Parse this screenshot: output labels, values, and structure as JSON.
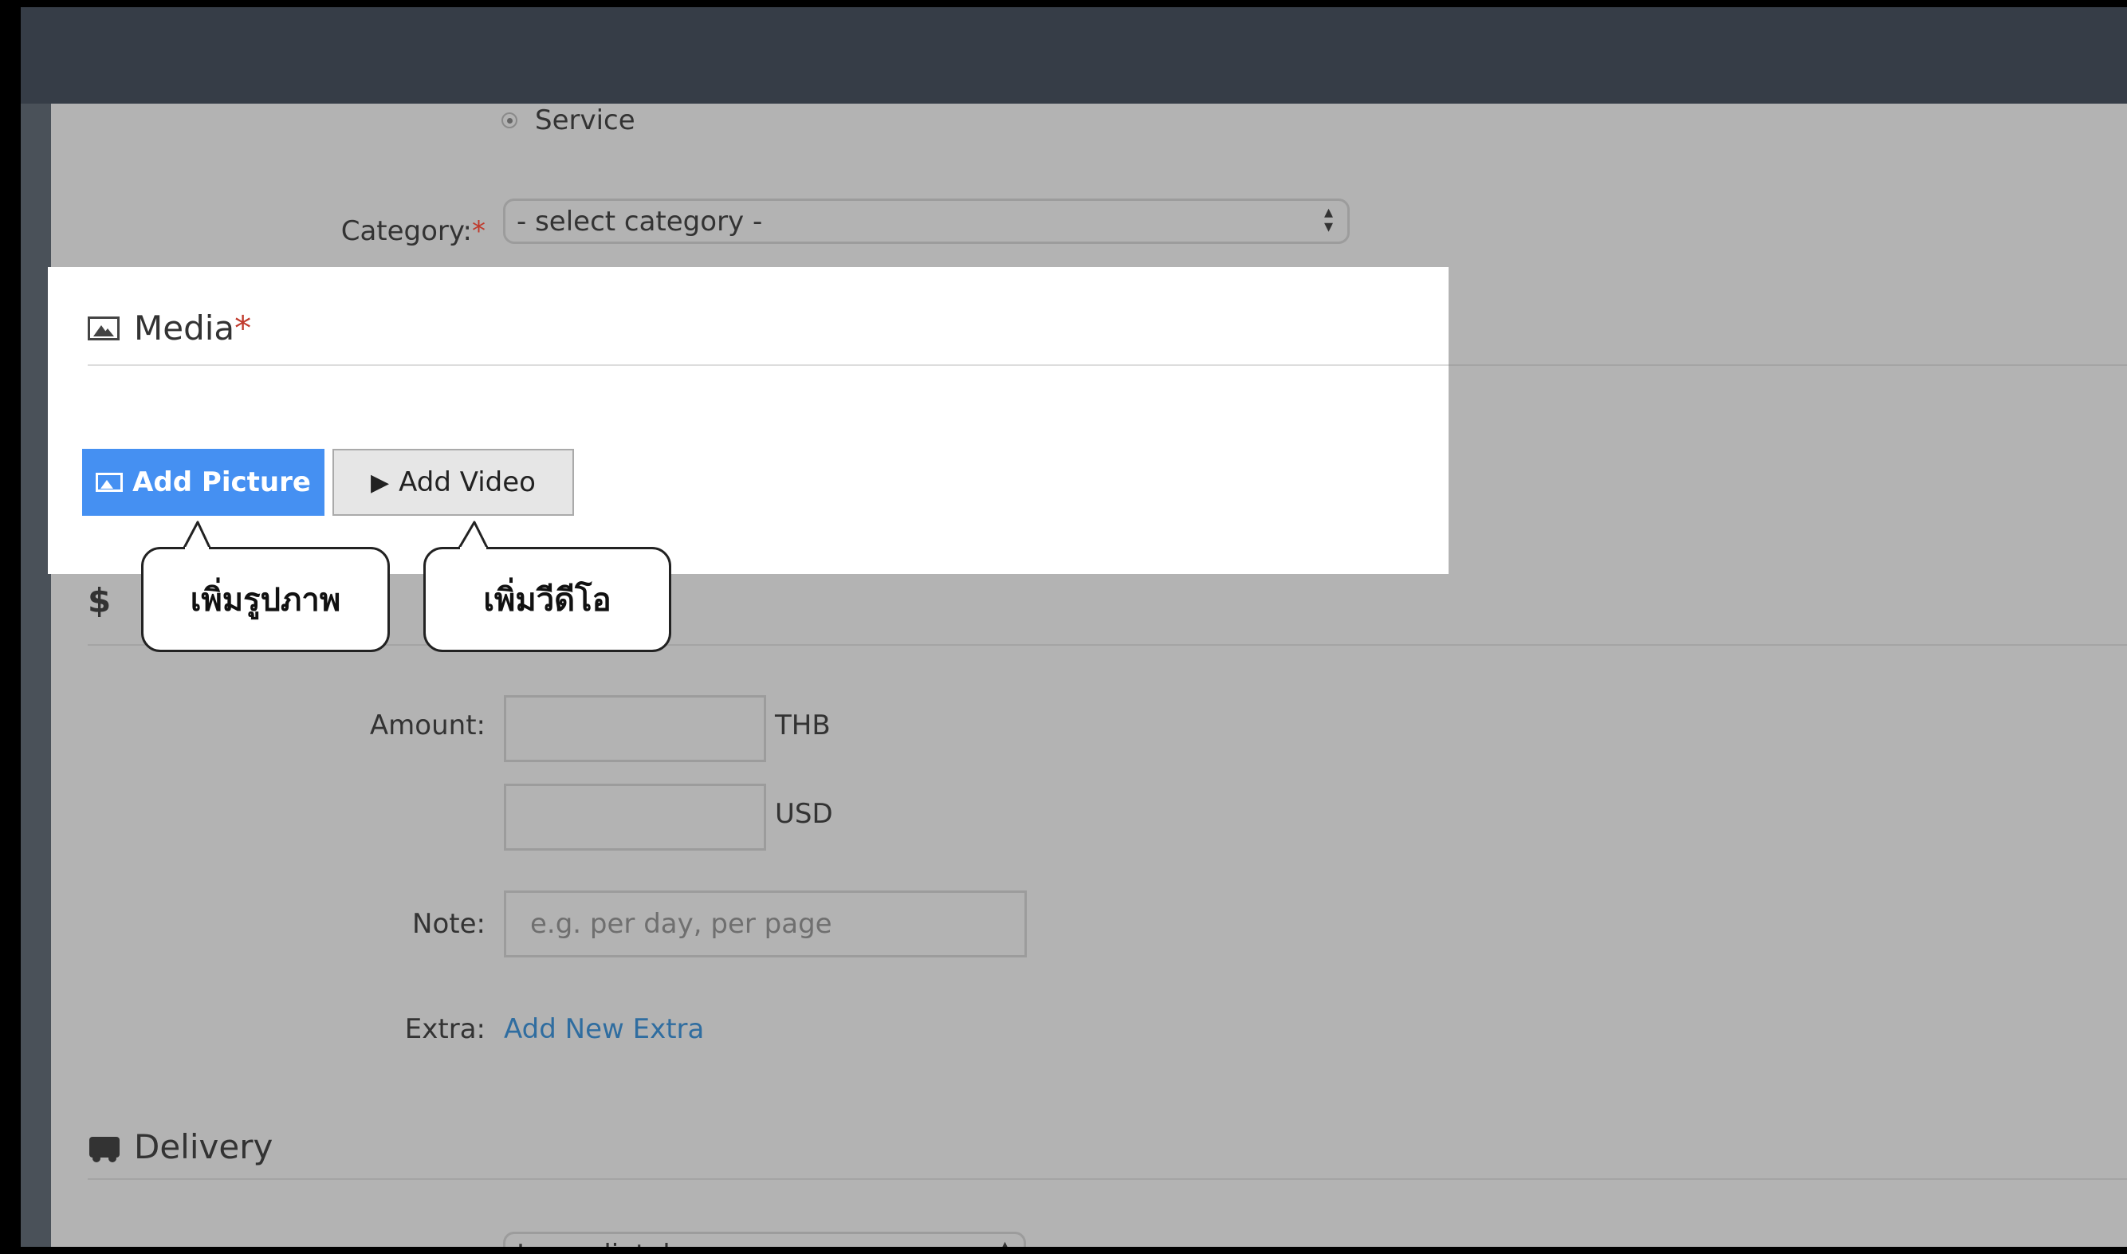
{
  "form": {
    "type_option": "Service",
    "category_label": "Category:",
    "category_required": "*",
    "category_placeholder": "- select category -",
    "media_title": "Media",
    "media_required": "*",
    "add_picture": "Add Picture",
    "add_video": "Add Video",
    "price_icon": "$",
    "amount_label": "Amount:",
    "currency_1": "THB",
    "currency_2": "USD",
    "note_label": "Note:",
    "note_placeholder": "e.g. per day, per page",
    "extra_label": "Extra:",
    "extra_link": "Add New Extra",
    "delivery_title": "Delivery",
    "delivery_value": "Immediately"
  },
  "callouts": {
    "picture": "เพิ่มรูปภาพ",
    "video": "เพิ่มวีดีโอ"
  },
  "colors": {
    "primary_button": "#4590f2",
    "overlay": "#b3b3b3",
    "topbar": "#363d47",
    "required": "#c0392b",
    "link": "#2f6da0"
  }
}
